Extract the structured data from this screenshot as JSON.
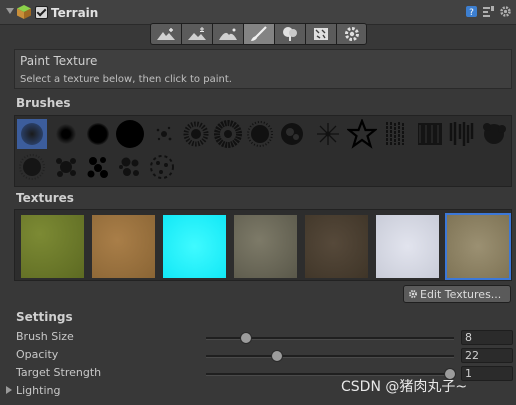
{
  "header": {
    "title": "Terrain",
    "icons": [
      "help-icon",
      "presets-icon",
      "settings-icon"
    ]
  },
  "toolbar": {
    "tools": [
      {
        "name": "raise-lower-terrain-icon",
        "active": false
      },
      {
        "name": "paint-height-icon",
        "active": false
      },
      {
        "name": "smooth-height-icon",
        "active": false
      },
      {
        "name": "paint-texture-icon",
        "active": true
      },
      {
        "name": "place-trees-icon",
        "active": false
      },
      {
        "name": "paint-details-icon",
        "active": false
      },
      {
        "name": "terrain-settings-icon",
        "active": false
      }
    ]
  },
  "info": {
    "title": "Paint Texture",
    "description": "Select a texture below, then click to paint."
  },
  "brushes": {
    "heading": "Brushes",
    "selected_index": 0
  },
  "textures": {
    "heading": "Textures",
    "items": [
      {
        "name": "grass-texture",
        "color": "#6b7a2a"
      },
      {
        "name": "dirt-texture",
        "color": "#9b7440"
      },
      {
        "name": "cyan-texture",
        "color": "#18f4ff"
      },
      {
        "name": "rock-moss-texture",
        "color": "#6e6b59"
      },
      {
        "name": "dark-soil-texture",
        "color": "#4c4232"
      },
      {
        "name": "snow-texture",
        "color": "#d6d9e4"
      },
      {
        "name": "gravel-texture",
        "color": "#8f8466"
      }
    ],
    "selected_index": 6,
    "edit_button": "Edit Textures..."
  },
  "settings": {
    "heading": "Settings",
    "brush_size": {
      "label": "Brush Size",
      "value": "8",
      "fraction": 0.08
    },
    "opacity": {
      "label": "Opacity",
      "value": "22",
      "fraction": 0.22
    },
    "target_strength": {
      "label": "Target Strength",
      "value": "1",
      "fraction": 1.0
    }
  },
  "lighting": {
    "label": "Lighting"
  },
  "watermark": "CSDN @猪肉丸子~"
}
